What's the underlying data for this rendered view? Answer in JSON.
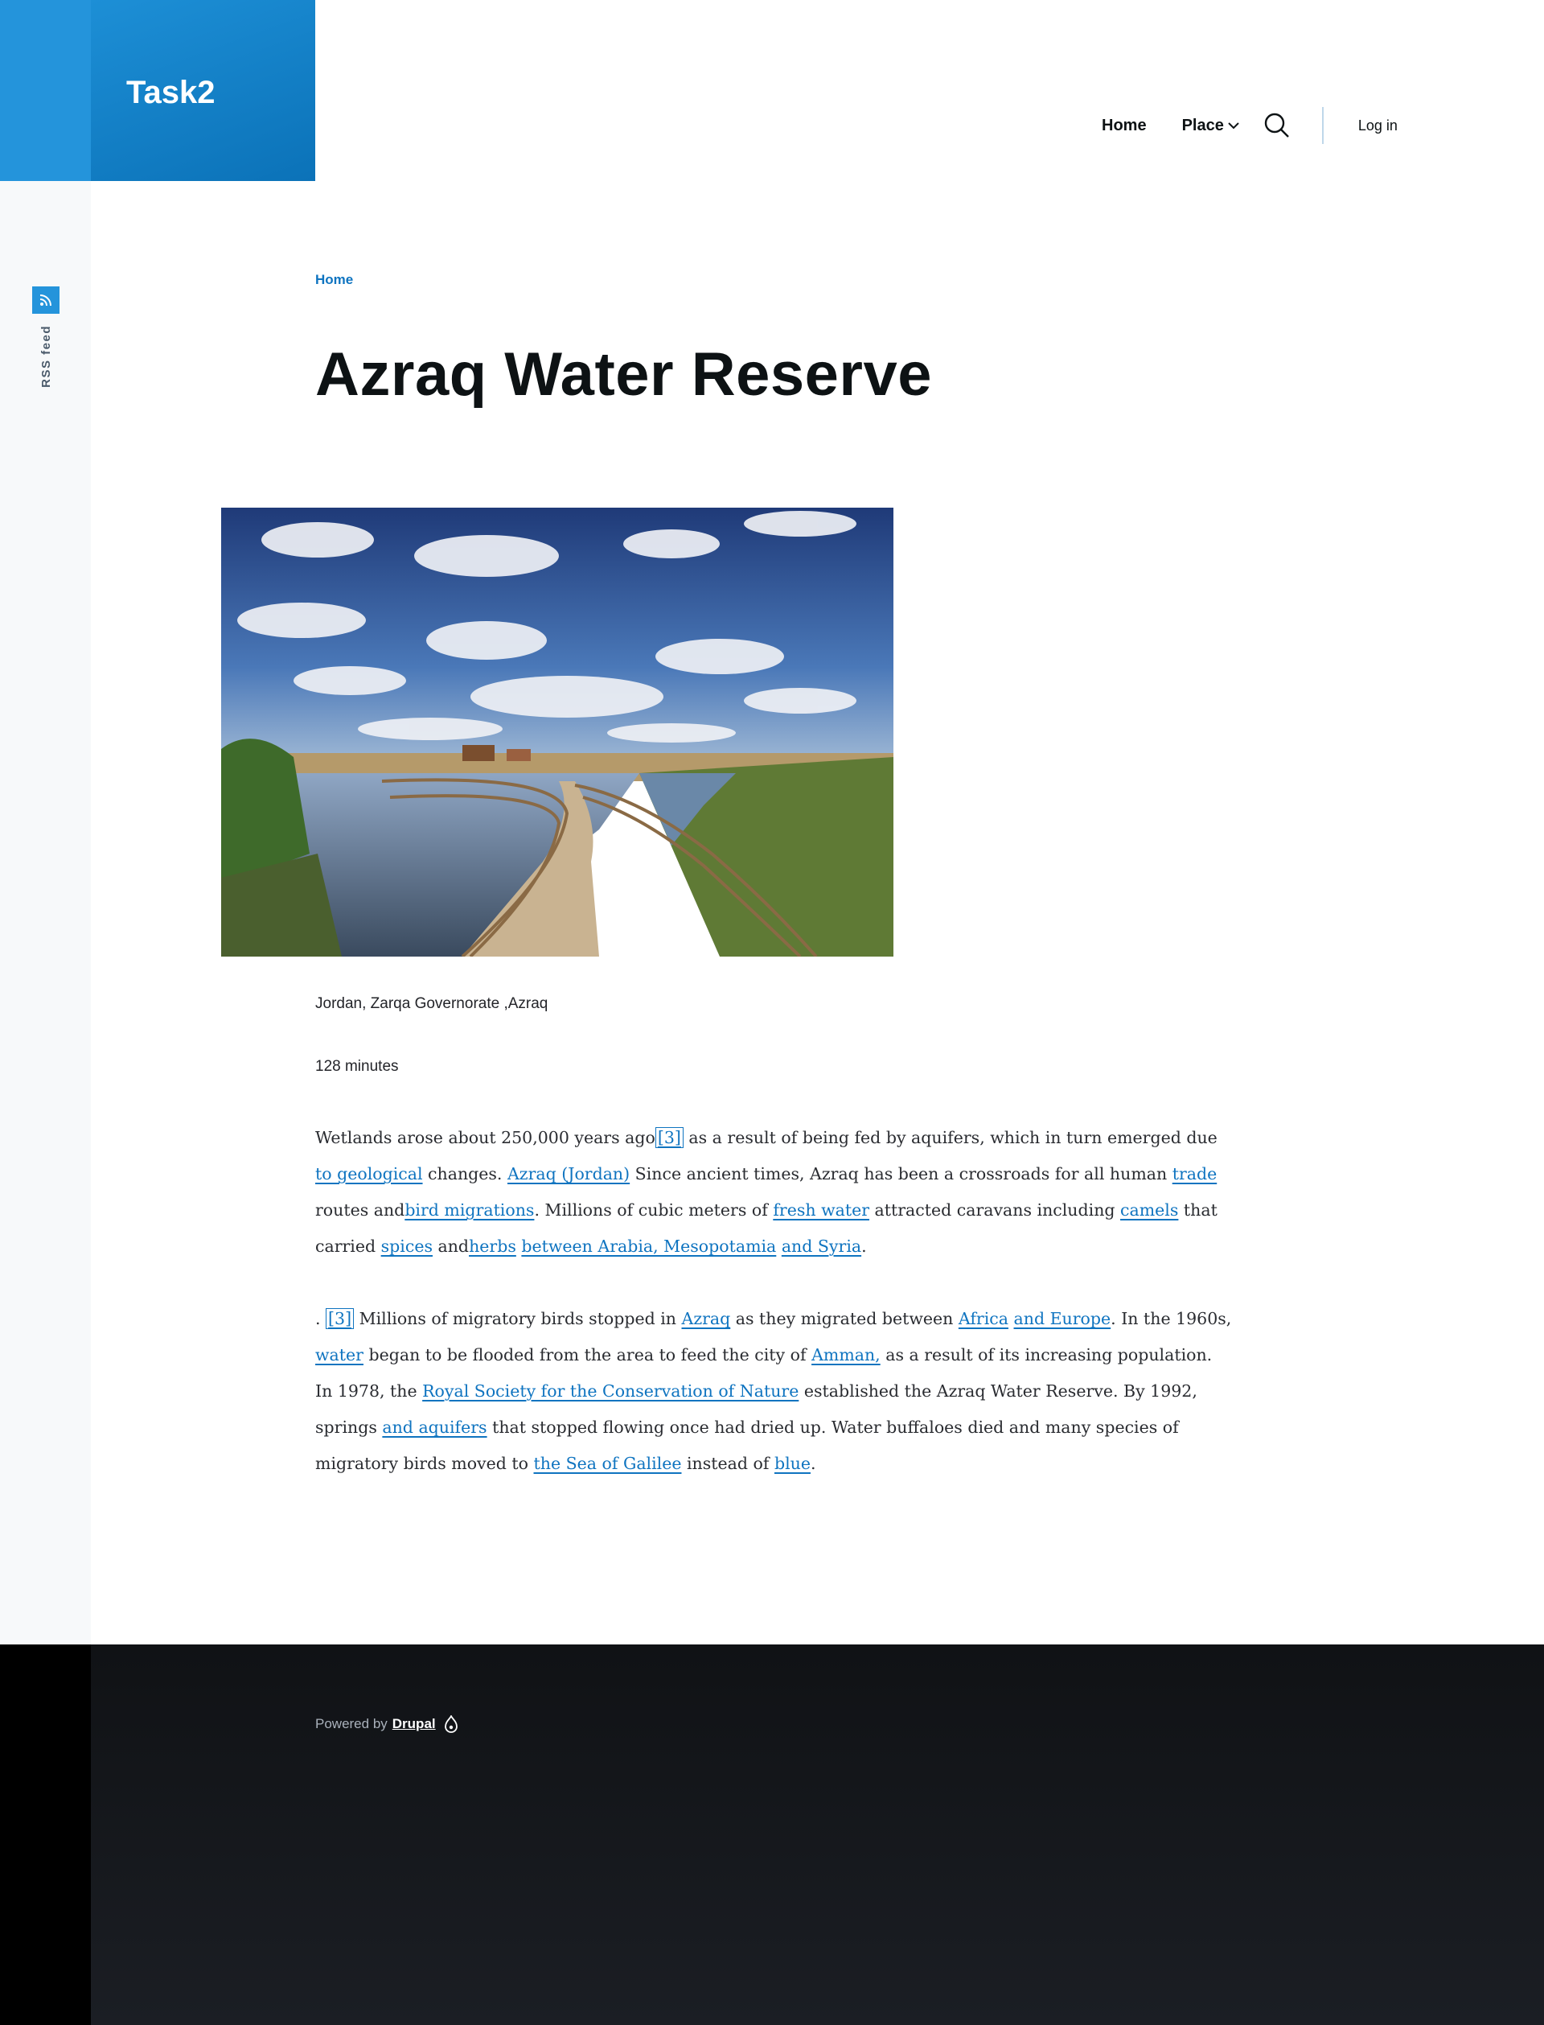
{
  "site": {
    "name": "Task2"
  },
  "nav": {
    "home": "Home",
    "place": "Place",
    "login": "Log in"
  },
  "sidebar": {
    "rss_label": "RSS feed"
  },
  "breadcrumb": {
    "home": "Home"
  },
  "article": {
    "title": "Azraq Water Reserve",
    "location": "Jordan, Zarqa Governorate ,Azraq",
    "duration": "128 minutes",
    "paragraph1": {
      "t1": "Wetlands arose about 250,000 years ago",
      "l1": "[3]",
      "t2": " as a result of being fed by aquifers, which in turn emerged due ",
      "l2": "to geological",
      "t3": " changes. ",
      "l3": "Azraq (Jordan)",
      "t4": " Since ancient times, Azraq has been a crossroads for all human ",
      "l4": "trade",
      "t5": " routes and",
      "l5": "bird migrations",
      "t6": ". Millions of cubic meters of ",
      "l6": "fresh water",
      "t7": " attracted caravans including ",
      "l7": "camels",
      "t8": " that carried ",
      "l8": "spices",
      "t9": " and",
      "l9": "herbs",
      "t10": " ",
      "l10": "between Arabia, Mesopotamia",
      "t11": " ",
      "l11": "and Syria",
      "t12": "."
    },
    "paragraph2": {
      "t1": ". ",
      "l1": "[3]",
      "t2": " Millions of migratory birds stopped in ",
      "l2": "Azraq",
      "t3": " as they migrated between ",
      "l3": "Africa",
      "t4": " ",
      "l4": "and Europe",
      "t5": ".  In the 1960s, ",
      "l5": "water",
      "t6": " began to be flooded from the area to feed the city of ",
      "l6": "Amman,",
      "t7": " as a result of its increasing population.  In 1978, the ",
      "l7": "Royal Society for the Conservation of Nature",
      "t8": " established the Azraq Water Reserve.  By 1992, springs ",
      "l8": "and aquifers",
      "t9": " that stopped flowing once had dried up. Water buffaloes died and many species of migratory birds moved to ",
      "l9": "the Sea of Galilee",
      "t10": " instead of ",
      "l10": "blue",
      "t11": "."
    }
  },
  "footer": {
    "powered_by": "Powered by",
    "drupal": "Drupal"
  },
  "colors": {
    "brand_blue": "#2494db",
    "link_blue": "#0f74c0",
    "footer_bg": "#14171b"
  },
  "icons": {
    "rss": "rss-icon",
    "search": "search-icon",
    "chevron": "chevron-down-icon",
    "drupal": "drupal-icon"
  }
}
